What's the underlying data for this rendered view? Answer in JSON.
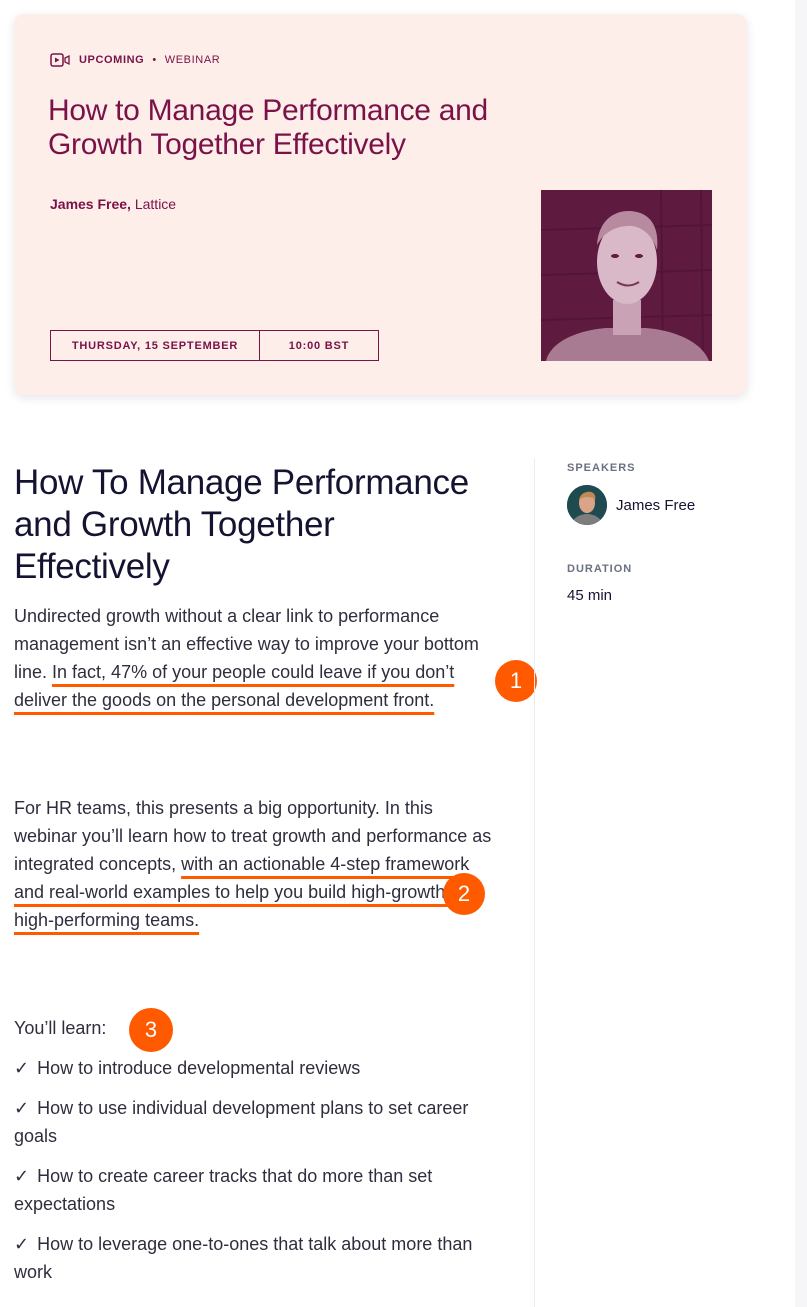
{
  "hero": {
    "status": "UPCOMING",
    "separator": "•",
    "type": "WEBINAR",
    "title": "How to Manage Performance and Growth Together Effectively",
    "speaker_name": "James Free,",
    "speaker_company": "Lattice",
    "date": "THURSDAY, 15 SEPTEMBER",
    "time": "10:00 BST",
    "accent_color": "#7a1248",
    "background_color": "#fdeeea"
  },
  "article": {
    "title": "How To Manage Performance and Growth Together Effectively",
    "paragraph1": {
      "plain": "Undirected growth without a clear link to performance management isn’t an effective way to improve your bottom line. ",
      "highlighted": "In fact, 47% of your people could leave if you don’t deliver the goods on the personal development front."
    },
    "paragraph2": {
      "plain": "For HR teams, this presents a big opportunity.  In this webinar you’ll learn how to treat growth and performance as integrated concepts, ",
      "highlighted": "with an actionable 4-step framework and real-world examples to help you build high-growth, high-performing teams."
    },
    "learn_label": "You’ll learn:",
    "learn_items": [
      {
        "check": "✓",
        "text": "How to introduce developmental reviews"
      },
      {
        "check": "✓",
        "text": "How to use individual development plans to set career goals"
      },
      {
        "check": "✓",
        "text": "How to create career tracks that do more than set expectations"
      },
      {
        "check": "✓",
        "text": "How to leverage one-to-ones that talk about more than work"
      }
    ]
  },
  "annotations": {
    "badges": [
      "1",
      "2",
      "3"
    ],
    "color": "#ff5a00"
  },
  "sidebar": {
    "speakers_label": "SPEAKERS",
    "speakers": [
      {
        "name": "James Free"
      }
    ],
    "duration_label": "DURATION",
    "duration_value": "45 min"
  }
}
